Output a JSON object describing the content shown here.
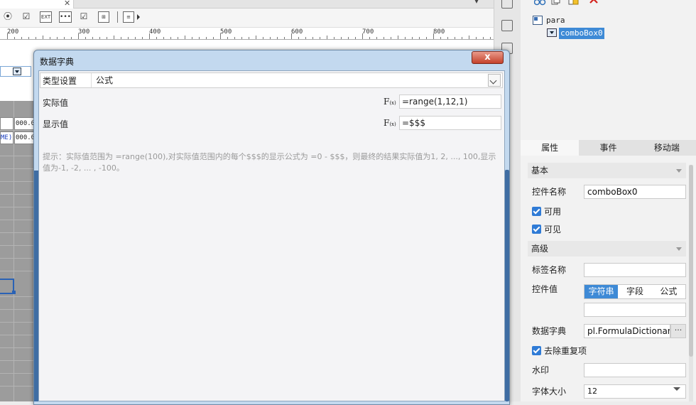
{
  "designer": {
    "toolbar": {
      "text_icon_label": "EXT"
    },
    "ruler": {
      "ticks": [
        "200",
        "300",
        "400",
        "500",
        "600",
        "700",
        "800"
      ]
    },
    "grid": {
      "cells": [
        "000.0",
        "000.0"
      ],
      "left_cells": [
        "",
        "ME)"
      ]
    }
  },
  "tree": {
    "root_label": "para",
    "child_label": "comboBox0"
  },
  "properties": {
    "tabs": [
      "属性",
      "事件",
      "移动端"
    ],
    "active_tab": "属性",
    "basic": {
      "title": "基本",
      "widget_name_label": "控件名称",
      "widget_name_value": "comboBox0",
      "enabled_label": "可用",
      "visible_label": "可见"
    },
    "advanced": {
      "title": "高级",
      "tag_name_label": "标签名称",
      "tag_name_value": "",
      "widget_value_label": "控件值",
      "widget_value_options": [
        "字符串",
        "字段",
        "公式"
      ],
      "widget_value_selected": "字符串",
      "widget_value_text": "",
      "dictionary_label": "数据字典",
      "dictionary_value": "pl.FormulaDictionary",
      "dictionary_button": "···",
      "dedupe_label": "去除重复项",
      "watermark_label": "水印",
      "watermark_value": "",
      "font_size_label": "字体大小",
      "font_size_value": "12"
    }
  },
  "dialog": {
    "title": "数据字典",
    "close_label": "x",
    "type_label": "类型设置",
    "type_value": "公式",
    "actual_label": "实际值",
    "actual_value": "=range(1,12,1)",
    "display_label": "显示值",
    "display_value": "=$$$",
    "fx_label": "F",
    "fx_sub": "(x)",
    "hint": "提示：实际值范围为 =range(100),对实际值范围内的每个$$$的显示公式为 =0 - $$$，则最终的结果实际值为1, 2, ..., 100,显示值为-1, -2, ... , -100。"
  },
  "colors": {
    "accent": "#3e8ad6",
    "dialog_frame": "#c3d9ef",
    "close_red": "#c5422c"
  }
}
